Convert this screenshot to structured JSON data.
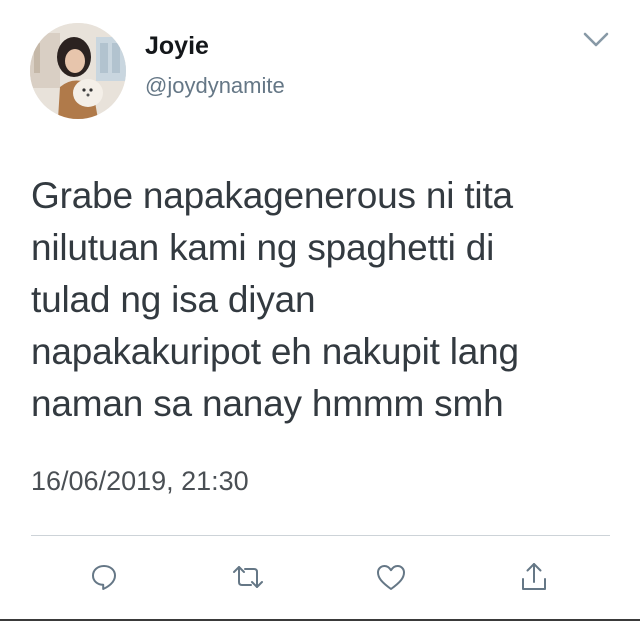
{
  "user": {
    "display_name": "Joyie",
    "handle": "@joydynamite"
  },
  "tweet": {
    "text": "Grabe napakagenerous ni tita\nnilutuan kami ng spaghetti di\ntulad ng isa diyan\nnapakakuripot eh nakupit lang\nnaman sa nanay hmmm smh",
    "timestamp": "16/06/2019, 21:30"
  },
  "icons": {
    "menu": "chevron-down-icon",
    "reply": "reply-icon",
    "retweet": "retweet-icon",
    "like": "heart-icon",
    "share": "share-icon"
  },
  "colors": {
    "text": "#14171a",
    "secondary": "#657786",
    "icon": "#657786",
    "divider": "#cdd3d8"
  }
}
